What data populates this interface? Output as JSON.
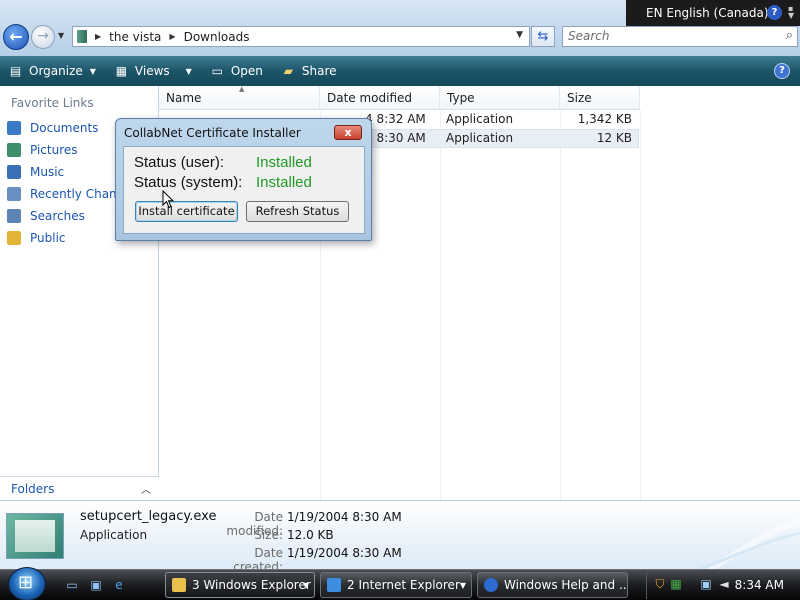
{
  "langbar": {
    "label": "EN English (Canada)",
    "help": "?"
  },
  "address": {
    "crumbs": [
      "the vista",
      "Downloads"
    ],
    "search_placeholder": "Search"
  },
  "commandbar": {
    "organize": "Organize",
    "views": "Views",
    "open": "Open",
    "share": "Share"
  },
  "navpane": {
    "title": "Favorite Links",
    "items": [
      {
        "label": "Documents",
        "icon": "documents-icon",
        "color": "#3a7bc8"
      },
      {
        "label": "Pictures",
        "icon": "pictures-icon",
        "color": "#3d8f6a"
      },
      {
        "label": "Music",
        "icon": "music-icon",
        "color": "#3b6fb8"
      },
      {
        "label": "Recently Changed",
        "icon": "recent-icon",
        "color": "#6a8fc2"
      },
      {
        "label": "Searches",
        "icon": "searches-icon",
        "color": "#5b83b5"
      },
      {
        "label": "Public",
        "icon": "public-folder-icon",
        "color": "#e3b338"
      }
    ],
    "folders_label": "Folders"
  },
  "filelist": {
    "columns": [
      "Name",
      "Date modified",
      "Type",
      "Size"
    ],
    "rows": [
      {
        "date_partial": "4 8:32 AM",
        "type": "Application",
        "size": "1,342 KB"
      },
      {
        "date_partial": "4 8:30 AM",
        "type": "Application",
        "size": "12 KB"
      }
    ]
  },
  "dialog": {
    "title": "CollabNet Certificate Installer",
    "close": "x",
    "user_label": "Status (user):",
    "user_value": "Installed",
    "system_label": "Status (system):",
    "system_value": "Installed",
    "install_button": "Install certificate",
    "refresh_button": "Refresh Status",
    "status_color": "#1f9a22"
  },
  "details": {
    "filename": "setupcert_legacy.exe",
    "filetype": "Application",
    "date_modified_label": "Date modified:",
    "date_modified": "1/19/2004 8:30 AM",
    "size_label": "Size:",
    "size": "12.0 KB",
    "date_created_label": "Date created:",
    "date_created": "1/19/2004 8:30 AM"
  },
  "taskbar": {
    "buttons": [
      "3 Windows Explorer",
      "2 Internet Explorer",
      "Windows Help and ..."
    ],
    "clock": "8:34 AM"
  }
}
